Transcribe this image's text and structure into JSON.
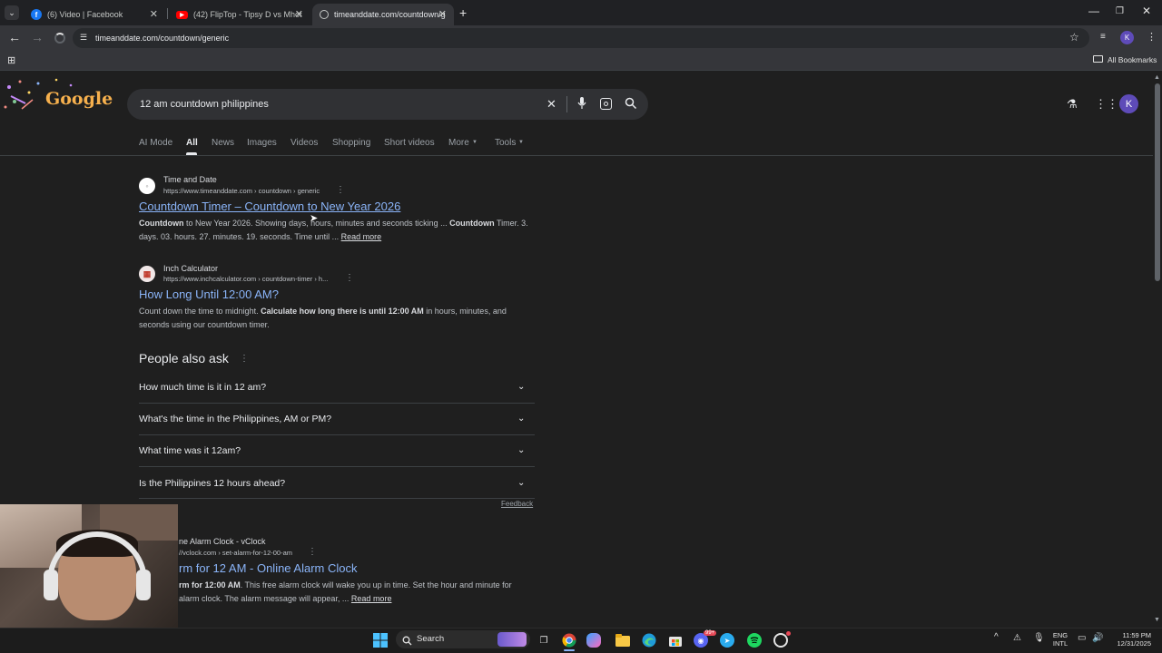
{
  "browser": {
    "tabs": [
      {
        "title": "(6) Video | Facebook"
      },
      {
        "title": "(42) FlipTop - Tipsy D vs Mhot"
      },
      {
        "title": "timeanddate.com/countdown/g"
      }
    ],
    "url": "timeanddate.com/countdown/generic",
    "bookmarks_label": "All Bookmarks",
    "profile_initial": "K"
  },
  "search": {
    "query": "12 am countdown philippines",
    "logo_text": "Google",
    "account_initial": "K"
  },
  "nav_tabs": [
    {
      "label": "AI Mode"
    },
    {
      "label": "All"
    },
    {
      "label": "News"
    },
    {
      "label": "Images"
    },
    {
      "label": "Videos"
    },
    {
      "label": "Shopping"
    },
    {
      "label": "Short videos"
    },
    {
      "label": "More"
    },
    {
      "label": "Tools"
    }
  ],
  "results": [
    {
      "site": "Time and Date",
      "url": "https://www.timeanddate.com › countdown › generic",
      "title": "Countdown Timer – Countdown to New Year 2026",
      "snippet_b1": "Countdown",
      "snippet_t1": " to New Year 2026. Showing days, hours, minutes and seconds ticking ... ",
      "snippet_b2": "Countdown",
      "snippet_t2": " Timer. 3. days. 03. hours. 27. minutes. 19. seconds. Time until ... ",
      "read_more": "Read more"
    },
    {
      "site": "Inch Calculator",
      "url": "https://www.inchcalculator.com › countdown-timer › h...",
      "title": "How Long Until 12:00 AM?",
      "snippet_t1": "Count down the time to midnight. ",
      "snippet_b1": "Calculate how long there is until 12:00 AM",
      "snippet_t2": " in hours, minutes, and seconds using our countdown timer."
    },
    {
      "site": "ne Alarm Clock - vClock",
      "url": "//vclock.com › set-alarm-for-12-00-am",
      "title": "rm for 12 AM - Online Alarm Clock",
      "snippet_b1": "rm for 12:00 AM",
      "snippet_t1": ". This free alarm clock will wake you up in time. Set the hour and minute for",
      "snippet_t2": "alarm clock. The alarm message will appear, ... ",
      "read_more": "Read more"
    }
  ],
  "people_also_ask": {
    "title": "People also ask",
    "questions": [
      "How much time is it in 12 am?",
      "What's the time in the Philippines, AM or PM?",
      "What time was it 12am?",
      "Is the Philippines 12 hours ahead?"
    ],
    "feedback": "Feedback"
  },
  "taskbar": {
    "search_label": "Search",
    "lang_line1": "ENG",
    "lang_line2": "INTL",
    "time": "11:59 PM",
    "date": "12/31/2025",
    "badge": "99+"
  }
}
